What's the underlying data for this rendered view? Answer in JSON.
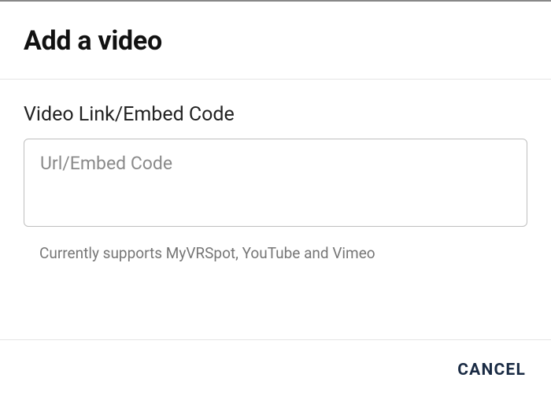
{
  "header": {
    "title": "Add a video"
  },
  "form": {
    "label": "Video Link/Embed Code",
    "placeholder": "Url/Embed Code",
    "helper": "Currently supports MyVRSpot, YouTube and Vimeo"
  },
  "footer": {
    "cancel": "CANCEL"
  }
}
